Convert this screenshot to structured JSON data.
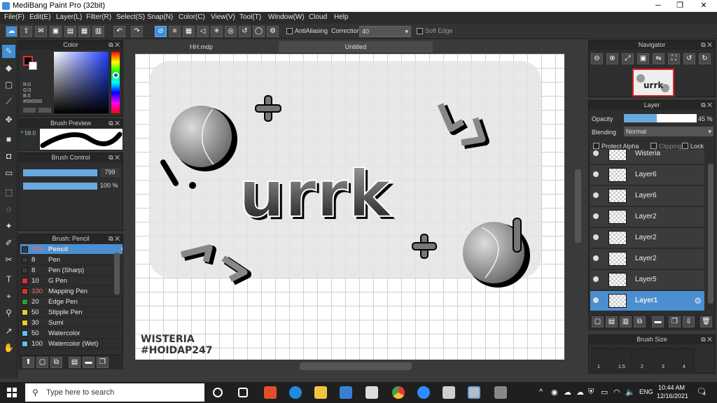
{
  "window": {
    "title": "MediBang Paint Pro (32bit)",
    "minimize": "─",
    "maximize": "❐",
    "close": "✕"
  },
  "menu": [
    "File(F)",
    "Edit(E)",
    "Layer(L)",
    "Filter(R)",
    "Select(S)",
    "Snap(N)",
    "Color(C)",
    "View(V)",
    "Tool(T)",
    "Window(W)",
    "Cloud",
    "Help"
  ],
  "toolbar": {
    "antialiasing_label": "AntiAliasing",
    "correction_label": "Correction",
    "correction_value": "40",
    "soft_edge_label": "Soft Edge"
  },
  "panels": {
    "color": {
      "title": "Color",
      "r": "R:0",
      "g": "G:0",
      "b": "B:0",
      "hex": "#000000",
      "primary": "#000000",
      "secondary": "#ffffff"
    },
    "brush_preview": {
      "title": "Brush Preview",
      "size": "* 58.0"
    },
    "brush_control": {
      "title": "Brush Control",
      "size_value": "799",
      "opacity_value": "100 %",
      "size_fill": 1.0,
      "opacity_fill": 1.0
    },
    "brush_list": {
      "title": "Brush: Pencil",
      "items": [
        {
          "size": "799",
          "name": "Pencil",
          "color": "#3b3b3b"
        },
        {
          "size": "8",
          "name": "Pen",
          "color": "#3b3b3b"
        },
        {
          "size": "8",
          "name": "Pen (Sharp)",
          "color": "#3b3b3b"
        },
        {
          "size": "10",
          "name": "G Pen",
          "color": "#e03030"
        },
        {
          "size": "330",
          "name": "Mapping Pen",
          "color": "#e03030"
        },
        {
          "size": "20",
          "name": "Edge Pen",
          "color": "#2fa030"
        },
        {
          "size": "50",
          "name": "Stipple Pen",
          "color": "#e0d030"
        },
        {
          "size": "30",
          "name": "Sumi",
          "color": "#e0d030"
        },
        {
          "size": "50",
          "name": "Watercolor",
          "color": "#60c0f0"
        },
        {
          "size": "100",
          "name": "Watercolor (Wet)",
          "color": "#60c0f0"
        }
      ]
    },
    "navigator": {
      "title": "Navigator"
    },
    "layer": {
      "title": "Layer",
      "opacity_label": "Opacity",
      "opacity_value": "45 %",
      "opacity_fill": 0.45,
      "blending_label": "Blending",
      "blending_value": "Normal",
      "protect_alpha": "Protect Alpha",
      "clipping": "Clipping",
      "lock": "Lock",
      "layers": [
        "Wisteria",
        "Layer6",
        "Layer6",
        "Layer2",
        "Layer2",
        "Layer2",
        "Layer5",
        "Layer1"
      ]
    },
    "brush_size": {
      "title": "Brush Size",
      "sizes": [
        "1",
        "1.5",
        "2",
        "3",
        "4"
      ]
    }
  },
  "tabs": [
    "HH.mdp",
    "Untitled"
  ],
  "canvas": {
    "artwork_text": "urrk",
    "watermark_line1": "WISTERIA",
    "watermark_line2": "#HOIDAP247"
  },
  "taskbar": {
    "search_placeholder": "Type here to search",
    "time": "10:44 AM",
    "date": "12/16/2021",
    "lang": "ENG",
    "notifications": "4"
  }
}
